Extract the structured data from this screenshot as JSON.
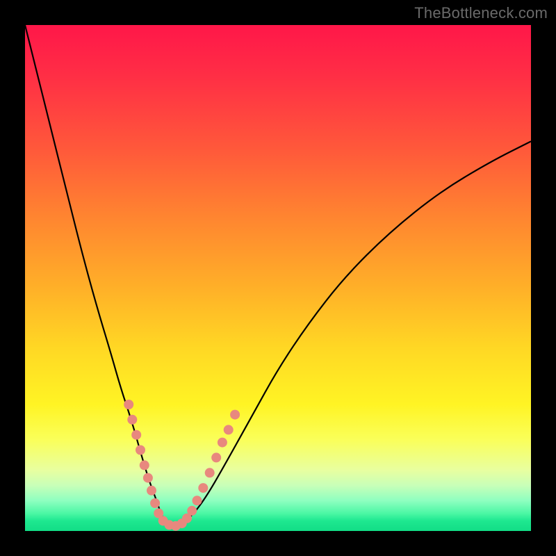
{
  "watermark": "TheBottleneck.com",
  "colors": {
    "curve": "#000000",
    "dot": "#e8887e",
    "grid_bg_top": "#ff1749",
    "grid_bg_bottom": "#12dd86",
    "frame": "#000000"
  },
  "chart_data": {
    "type": "line",
    "title": "",
    "xlabel": "",
    "ylabel": "",
    "xlim": [
      0,
      100
    ],
    "ylim": [
      0,
      100
    ],
    "annotations": [],
    "series": [
      {
        "name": "bottleneck-curve",
        "x": [
          0,
          2,
          5,
          8,
          11,
          14,
          17,
          19,
          21,
          23,
          24.5,
          26,
          27,
          28,
          29.5,
          31,
          33,
          36,
          40,
          45,
          50,
          56,
          63,
          72,
          82,
          92,
          100
        ],
        "y": [
          100,
          92,
          80,
          68,
          56,
          45,
          35,
          28,
          22,
          15,
          10,
          6,
          3,
          1.5,
          1,
          1.5,
          3,
          7,
          14,
          23,
          32,
          41,
          50,
          59,
          67,
          73,
          77
        ]
      }
    ],
    "markers": [
      {
        "x": 20.5,
        "y": 25.0
      },
      {
        "x": 21.2,
        "y": 22.0
      },
      {
        "x": 22.0,
        "y": 19.0
      },
      {
        "x": 22.8,
        "y": 16.0
      },
      {
        "x": 23.6,
        "y": 13.0
      },
      {
        "x": 24.3,
        "y": 10.5
      },
      {
        "x": 25.0,
        "y": 8.0
      },
      {
        "x": 25.7,
        "y": 5.5
      },
      {
        "x": 26.4,
        "y": 3.5
      },
      {
        "x": 27.3,
        "y": 2.0
      },
      {
        "x": 28.5,
        "y": 1.2
      },
      {
        "x": 29.8,
        "y": 1.0
      },
      {
        "x": 31.0,
        "y": 1.5
      },
      {
        "x": 32.0,
        "y": 2.5
      },
      {
        "x": 33.0,
        "y": 4.0
      },
      {
        "x": 34.0,
        "y": 6.0
      },
      {
        "x": 35.2,
        "y": 8.5
      },
      {
        "x": 36.5,
        "y": 11.5
      },
      {
        "x": 37.8,
        "y": 14.5
      },
      {
        "x": 39.0,
        "y": 17.5
      },
      {
        "x": 40.2,
        "y": 20.0
      },
      {
        "x": 41.5,
        "y": 23.0
      }
    ],
    "marker_radius_px": 7
  }
}
